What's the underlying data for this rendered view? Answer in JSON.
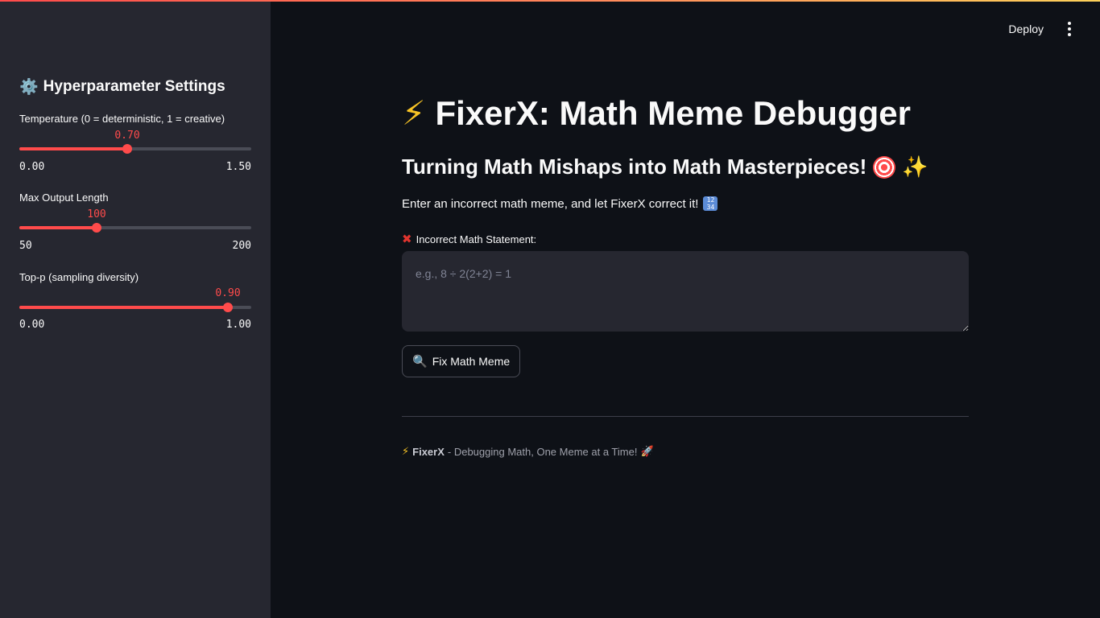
{
  "sidebar": {
    "title": "Hyperparameter Settings",
    "title_icon": "gear-icon",
    "sliders": [
      {
        "label": "Temperature (0 = deterministic, 1 = creative)",
        "value": "0.70",
        "min": "0.00",
        "max": "1.50",
        "fraction": 0.467
      },
      {
        "label": "Max Output Length",
        "value": "100",
        "min": "50",
        "max": "200",
        "fraction": 0.333
      },
      {
        "label": "Top-p (sampling diversity)",
        "value": "0.90",
        "min": "0.00",
        "max": "1.00",
        "fraction": 0.9
      }
    ]
  },
  "header": {
    "deploy_label": "Deploy",
    "menu_icon": "more-vertical-icon"
  },
  "main": {
    "title": "FixerX: Math Meme Debugger",
    "title_icon": "lightning-icon",
    "subtitle": "Turning Math Mishaps into Math Masterpieces!",
    "subtitle_icons": [
      "target-icon",
      "sparkles-icon"
    ],
    "intro": "Enter an incorrect math meme, and let FixerX correct it!",
    "intro_icon": "input-numbers-icon",
    "field_label": "Incorrect Math Statement:",
    "field_icon": "cross-mark-icon",
    "field_placeholder": "e.g., 8 ÷ 2(2+2) = 1",
    "field_value": "",
    "button_label": "Fix Math Meme",
    "button_icon": "magnifier-icon",
    "footer_brand": "FixerX",
    "footer_text": "- Debugging Math, One Meme at a Time!",
    "footer_icons": [
      "lightning-icon",
      "rocket-icon"
    ]
  },
  "colors": {
    "accent": "#ff4b4b",
    "background": "#0e1117",
    "sidebar": "#262730",
    "text": "#fafafa"
  }
}
